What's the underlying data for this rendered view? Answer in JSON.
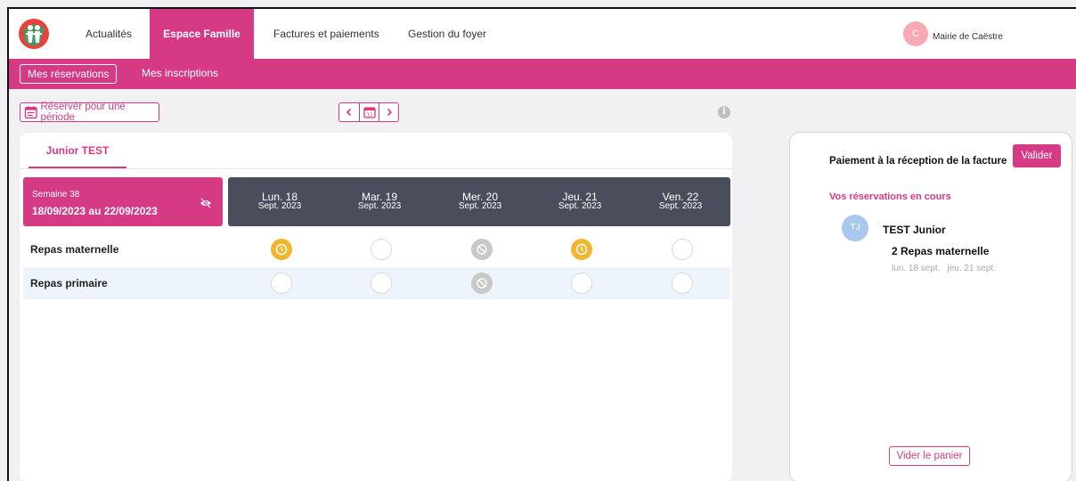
{
  "nav": {
    "items": [
      {
        "label": "Actualités",
        "active": false
      },
      {
        "label": "Espace Famille",
        "active": true
      },
      {
        "label": "Factures et paiements",
        "active": false
      },
      {
        "label": "Gestion du foyer",
        "active": false
      }
    ],
    "user": {
      "initial": "C",
      "name": "Mairie de Caëstre"
    }
  },
  "subnav": {
    "items": [
      {
        "label": "Mes réservations",
        "active": true
      },
      {
        "label": "Mes inscriptions",
        "active": false
      }
    ]
  },
  "toolbar": {
    "reserve_period": "Réserver pour une période",
    "calendar_day": "12",
    "info_glyph": "i"
  },
  "planning": {
    "child_tab": "Junior TEST",
    "week": {
      "label": "Semaine 38",
      "range": "18/09/2023 au 22/09/2023"
    },
    "days": [
      {
        "day": "Lun. 18",
        "month": "Sept. 2023"
      },
      {
        "day": "Mar. 19",
        "month": "Sept. 2023"
      },
      {
        "day": "Mer. 20",
        "month": "Sept. 2023"
      },
      {
        "day": "Jeu. 21",
        "month": "Sept. 2023"
      },
      {
        "day": "Ven. 22",
        "month": "Sept. 2023"
      }
    ],
    "rows": [
      {
        "label": "Repas maternelle",
        "states": [
          "reserved",
          "empty",
          "blocked",
          "reserved",
          "empty"
        ]
      },
      {
        "label": "Repas primaire",
        "states": [
          "empty",
          "empty",
          "blocked",
          "empty",
          "empty"
        ]
      }
    ]
  },
  "cart": {
    "payment_text": "Paiement à la réception de la facture",
    "validate_label": "Valider",
    "current_title": "Vos réservations en cours",
    "child_initials": "TJ",
    "child_name": "TEST Junior",
    "meal_summary": "2 Repas maternelle",
    "dates": [
      "lun. 18 sept.",
      "jeu. 21 sept."
    ],
    "empty_label": "Vider le panier"
  },
  "colors": {
    "brand": "#d63a84",
    "reserved": "#f0b62f",
    "blocked": "#c9c9c9",
    "dark_header": "#4a4e5c",
    "avatar_blue": "#a9c8ef",
    "avatar_pink": "#f7a9b4"
  }
}
